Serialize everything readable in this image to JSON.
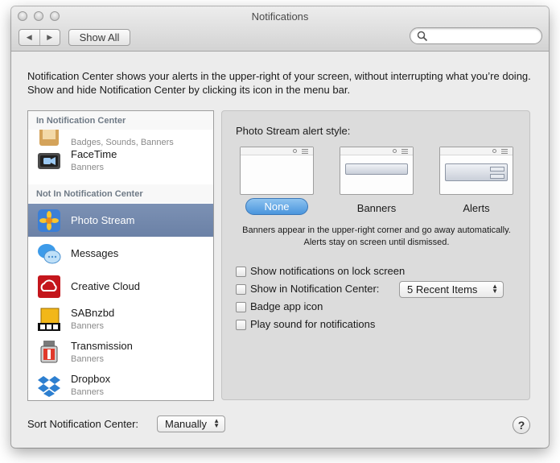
{
  "window": {
    "title": "Notifications"
  },
  "toolbar": {
    "back_icon": "chevron-left-icon",
    "forward_icon": "chevron-right-icon",
    "show_all_label": "Show All",
    "search_placeholder": ""
  },
  "description": "Notification Center shows your alerts in the upper-right of your screen, without interrupting what you’re doing. Show and hide Notification Center by clicking its icon in the menu bar.",
  "sidebar": {
    "in_header": "In Notification Center",
    "not_in_header": "Not In Notification Center",
    "in_items": [
      {
        "name": "",
        "subtitle": "Badges, Sounds, Banners",
        "icon": "app-icon"
      },
      {
        "name": "FaceTime",
        "subtitle": "Banners",
        "icon": "facetime-icon"
      }
    ],
    "not_in_items": [
      {
        "name": "Photo Stream",
        "subtitle": "",
        "icon": "photo-stream-icon",
        "selected": true
      },
      {
        "name": "Messages",
        "subtitle": "",
        "icon": "messages-icon"
      },
      {
        "name": "Creative Cloud",
        "subtitle": "",
        "icon": "creative-cloud-icon"
      },
      {
        "name": "SABnzbd",
        "subtitle": "Banners",
        "icon": "sabnzbd-icon"
      },
      {
        "name": "Transmission",
        "subtitle": "Banners",
        "icon": "transmission-icon"
      },
      {
        "name": "Dropbox",
        "subtitle": "Banners",
        "icon": "dropbox-icon"
      }
    ]
  },
  "panel": {
    "alert_style_label": "Photo Stream alert style:",
    "styles": [
      {
        "label": "None",
        "selected": true
      },
      {
        "label": "Banners",
        "selected": false
      },
      {
        "label": "Alerts",
        "selected": false
      }
    ],
    "note": "Banners appear in the upper-right corner and go away automatically. Alerts stay on screen until dismissed.",
    "options": [
      {
        "label": "Show notifications on lock screen",
        "checked": false
      },
      {
        "label": "Show in Notification Center:",
        "checked": false
      },
      {
        "label": "Badge app icon",
        "checked": false
      },
      {
        "label": "Play sound for notifications",
        "checked": false
      }
    ],
    "recent_items_value": "5 Recent Items"
  },
  "footer": {
    "sort_label": "Sort Notification Center:",
    "sort_value": "Manually",
    "help_label": "?"
  },
  "colors": {
    "selection": "#6f84a9",
    "none_button": "#4a95dd",
    "window_bg": "#ececec"
  }
}
